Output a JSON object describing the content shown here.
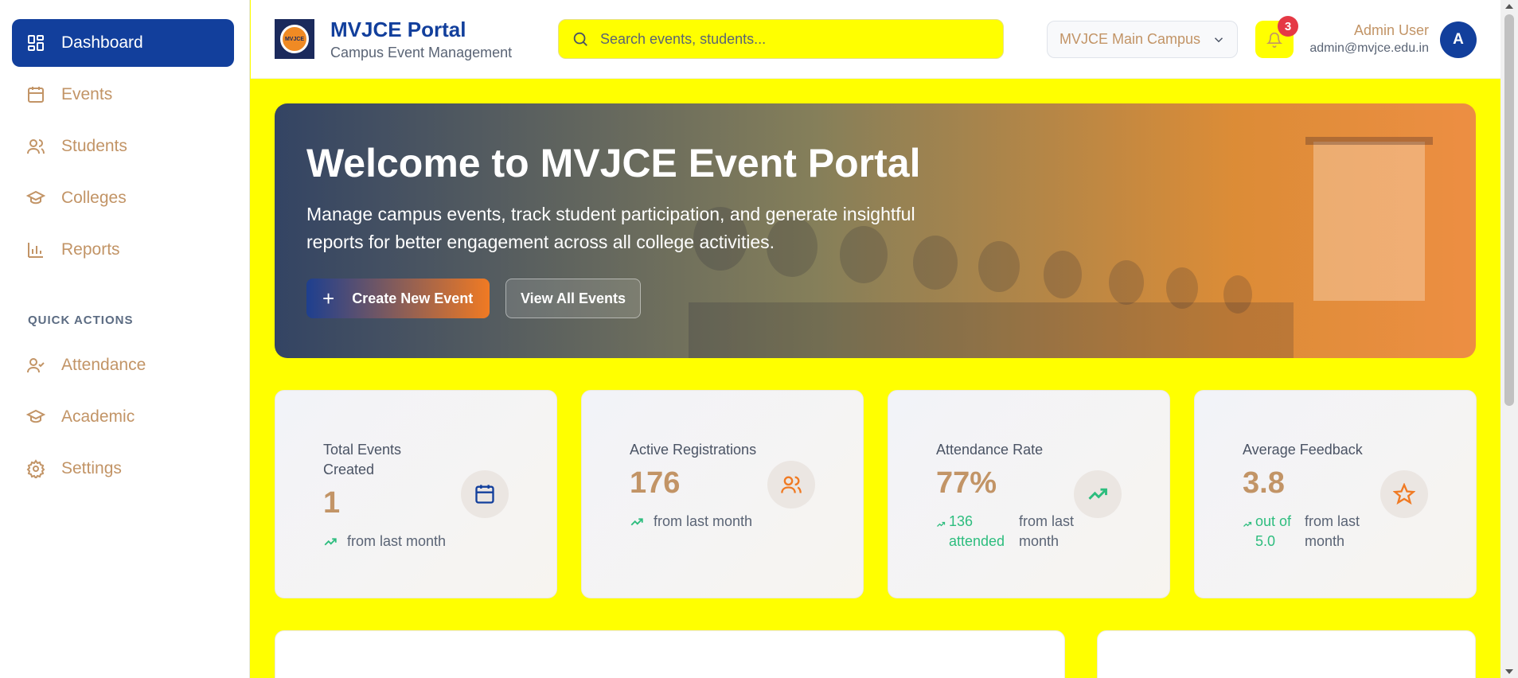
{
  "sidebar": {
    "items": [
      {
        "label": "Dashboard",
        "icon": "dashboard-icon",
        "active": true
      },
      {
        "label": "Events",
        "icon": "calendar-icon"
      },
      {
        "label": "Students",
        "icon": "users-icon"
      },
      {
        "label": "Colleges",
        "icon": "graduation-cap-icon"
      },
      {
        "label": "Reports",
        "icon": "bar-chart-icon"
      }
    ],
    "quick_actions_label": "QUICK ACTIONS",
    "quick_actions": [
      {
        "label": "Attendance",
        "icon": "user-check-icon"
      },
      {
        "label": "Academic",
        "icon": "graduation-cap-icon"
      },
      {
        "label": "Settings",
        "icon": "gear-icon"
      }
    ]
  },
  "header": {
    "brand_title": "MVJCE Portal",
    "brand_subtitle": "Campus Event Management",
    "logo_text": "MVJCE",
    "search_placeholder": "Search events, students...",
    "campus_selected": "MVJCE Main Campus",
    "notification_count": "3",
    "user_name": "Admin User",
    "user_email": "admin@mvjce.edu.in",
    "avatar_initial": "A"
  },
  "hero": {
    "title": "Welcome to MVJCE Event Portal",
    "text": "Manage campus events, track student participation, and generate insightful reports for better engagement across all college activities.",
    "primary_button": "Create New Event",
    "secondary_button": "View All Events"
  },
  "stats": [
    {
      "label": "Total Events Created",
      "value": "1",
      "trend_highlight": "",
      "trend_text": "from last month",
      "icon": "calendar-icon"
    },
    {
      "label": "Active Registrations",
      "value": "176",
      "trend_highlight": "",
      "trend_text": "from last month",
      "icon": "users-icon"
    },
    {
      "label": "Attendance Rate",
      "value": "77%",
      "trend_highlight": "136 attended",
      "trend_text": "from last month",
      "icon": "trending-up-icon"
    },
    {
      "label": "Average Feedback",
      "value": "3.8",
      "trend_highlight": "out of 5.0",
      "trend_text": "from last month",
      "icon": "star-icon"
    }
  ],
  "colors": {
    "primary": "#123f9c",
    "accent": "#f07a23",
    "highlight": "#ffff00",
    "label_tan": "#c29466",
    "trend_green": "#2dbd7e",
    "notification_red": "#e53945"
  }
}
